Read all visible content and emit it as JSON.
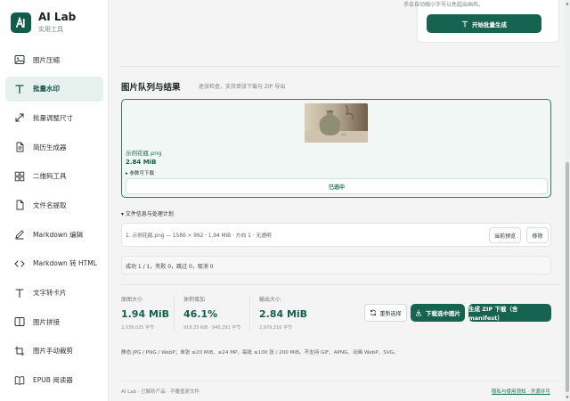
{
  "brand": {
    "title": "AI Lab",
    "subtitle": "实用工具"
  },
  "sidebar": {
    "items": [
      {
        "label": "图片压缩",
        "icon": "image-icon"
      },
      {
        "label": "批量水印",
        "icon": "text-icon",
        "active": true
      },
      {
        "label": "批量调整尺寸",
        "icon": "resize-icon"
      },
      {
        "label": "简历生成器",
        "icon": "document-icon"
      },
      {
        "label": "二维码工具",
        "icon": "grid-icon"
      },
      {
        "label": "文件名提取",
        "icon": "file-icon"
      },
      {
        "label": "Markdown 编辑",
        "icon": "pen-icon"
      },
      {
        "label": "Markdown 转 HTML",
        "icon": "code-icon"
      },
      {
        "label": "文字转卡片",
        "icon": "text-icon"
      },
      {
        "label": "图片拼接",
        "icon": "image-icon"
      },
      {
        "label": "图片手动裁剪",
        "icon": "crop-icon"
      },
      {
        "label": "EPUB 阅读器",
        "icon": "book-icon"
      }
    ]
  },
  "top": {
    "hint": "手会自动缩小字号以免超出画布。",
    "batch_button": "开始批量生成"
  },
  "queue": {
    "title": "图片队列与结果",
    "subtitle": "逐张检查，支持单张下载与 ZIP 导出",
    "file_name": "示例花瓶.png",
    "file_size": "2.84 MiB",
    "toggle_download": "▸ 参数可下载",
    "selected_label": "已选中"
  },
  "details": {
    "toggle": "▾ 文件信息与处理计划",
    "row_text": "1. 示例花瓶.png — 1586 × 992 · 1.94 MiB · 方向 1 · 无透明",
    "preview_button": "当前预览",
    "remove_button": "移除"
  },
  "status": {
    "text": "成功 1 / 1，失败 0，跳过 0，取消 0"
  },
  "stats": [
    {
      "label": "原图大小",
      "value": "1.94 MiB",
      "sub": "2,039,025 字节"
    },
    {
      "label": "体积增加",
      "value": "46.1%",
      "sub": "918.25 KiB · 940,291 字节"
    },
    {
      "label": "输出大小",
      "value": "2.84 MiB",
      "sub": "2,979,316 字节"
    }
  ],
  "actions": {
    "reselect": "重新选择",
    "download_selected": "下载选中图片",
    "zip": "生成 ZIP 下载（含 manifest）"
  },
  "formats": "静态 JPG / PNG / WebP；单张 ≤20 MiB、≤24 MP，每批 ≤100 张 / 200 MiB。不支持 GIF、APNG、动画 WebP、SVG。",
  "footer": {
    "left": "AI Lab · 已解析产品 · 不覆盖原文件",
    "right": "隐私与使用须知 · 开源许可"
  },
  "colors": {
    "accent": "#176351",
    "sidebar_active_bg": "#e6f0ec"
  }
}
